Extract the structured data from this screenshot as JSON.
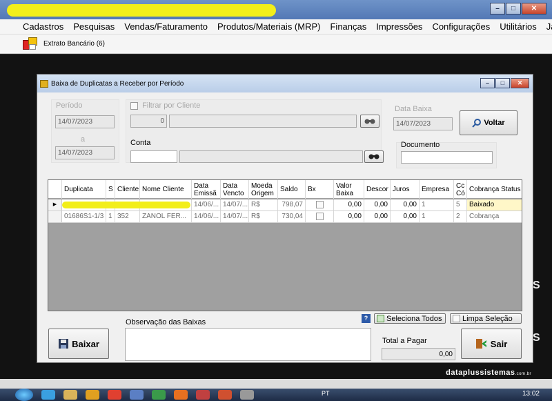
{
  "app": {
    "colors": {
      "titlebar": "#5378b5",
      "highlight_mark": "#f2ee1a",
      "selected_row_status": "#fff7c8"
    }
  },
  "window_controls": {
    "minimize": "–",
    "maximize": "□",
    "close": "✕"
  },
  "menu": [
    "Cadastros",
    "Pesquisas",
    "Vendas/Faturamento",
    "Produtos/Materiais (MRP)",
    "Finanças",
    "Impressões",
    "Configurações",
    "Utilitários",
    "Janelas"
  ],
  "toolbar": {
    "tab_label": "Extrato Bancário (6)"
  },
  "dialog": {
    "title": "Baixa de Duplicatas a Receber por Período",
    "periodo": {
      "label": "Período",
      "start": "14/07/2023",
      "separator": "a",
      "end": "14/07/2023"
    },
    "filtrar_cliente": {
      "label": "Filtrar por Cliente",
      "code": "0",
      "name": ""
    },
    "conta": {
      "label": "Conta",
      "code": "",
      "name": ""
    },
    "data_baixa": {
      "label": "Data Baixa",
      "value": "14/07/2023"
    },
    "documento": {
      "label": "Documento",
      "value": ""
    },
    "voltar_button": "Voltar",
    "grid": {
      "columns": [
        "Duplicata",
        "S",
        "Cliente",
        "Nome Cliente",
        "Data Emissã",
        "Data Vencto",
        "Moeda Origem",
        "Saldo",
        "Bx",
        "Valor Baixa",
        "Descor",
        "Juros",
        "Empresa",
        "Cc Có",
        "Cobrança Status"
      ],
      "rows": [
        {
          "selected": true,
          "redacted": true,
          "duplicata": "",
          "s": "",
          "cliente": "",
          "nome": "",
          "emissao": "14/06/...",
          "vencto": "14/07/...",
          "moeda": "R$",
          "saldo": "798,07",
          "bx": false,
          "valor_baixa": "0,00",
          "desconto": "0,00",
          "juros": "0,00",
          "empresa": "1",
          "cc": "5",
          "status": "Baixado"
        },
        {
          "selected": false,
          "redacted": false,
          "duplicata": "01686S1-1/3",
          "s": "1",
          "cliente": "352",
          "nome": "ZANOL FER...",
          "emissao": "14/06/...",
          "vencto": "14/07/...",
          "moeda": "R$",
          "saldo": "730,04",
          "bx": false,
          "valor_baixa": "0,00",
          "desconto": "0,00",
          "juros": "0,00",
          "empresa": "1",
          "cc": "2",
          "status": "Cobrança"
        }
      ]
    },
    "help_icon": "?",
    "seleciona_todos": "Seleciona Todos",
    "limpa_selecao": "Limpa Seleção",
    "observacao": {
      "label": "Observação das Baixas",
      "value": ""
    },
    "baixar_button": "Baixar",
    "total": {
      "label": "Total a Pagar",
      "value": "0,00"
    },
    "sair_button": "Sair"
  },
  "brand": {
    "name": "dataplussistemas",
    "suffix": ".com.br"
  },
  "taskbar": {
    "lang": "PT",
    "clock": "13:02"
  }
}
